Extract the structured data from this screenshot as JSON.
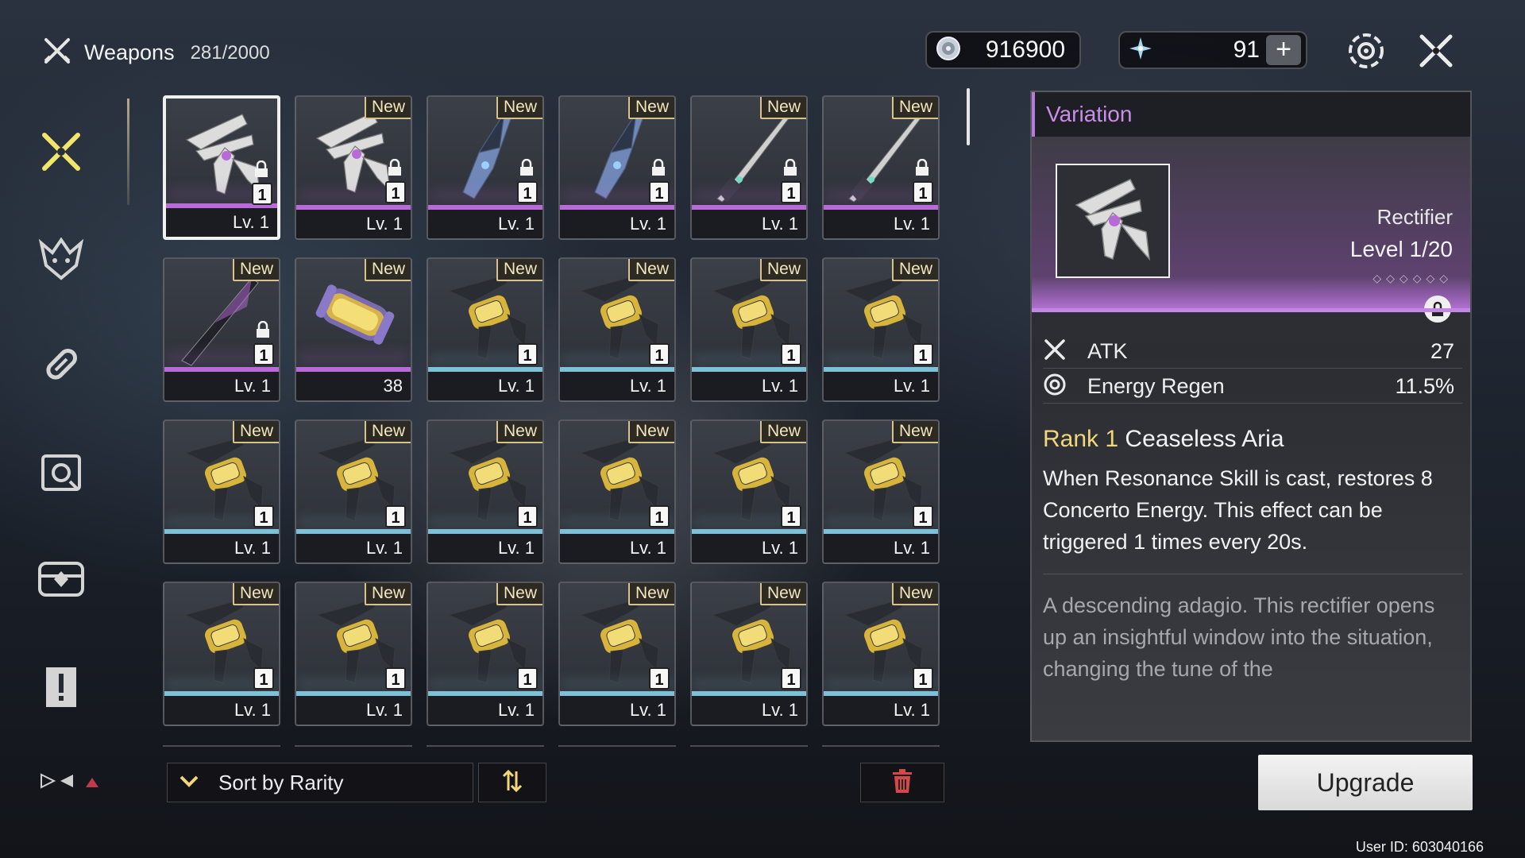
{
  "header": {
    "title": "Weapons",
    "count": "281/2000"
  },
  "currencies": [
    {
      "icon": "shell-credit-icon",
      "value": "916900"
    },
    {
      "icon": "astrite-icon",
      "value": "91",
      "plus": "+"
    }
  ],
  "top_icons": [
    "settings-gear-icon",
    "close-crossed-swords-icon"
  ],
  "nav": [
    "weapons-nav-icon",
    "echo-nav-icon",
    "device-nav-icon",
    "camera-nav-icon",
    "supply-nav-icon",
    "quest-item-nav-icon"
  ],
  "cards": [
    {
      "img": "rectifier-silver",
      "rar": "purple",
      "new": "",
      "lock": true,
      "badge": "1",
      "lv": "Lv. 1",
      "sel": true
    },
    {
      "img": "rectifier-silver",
      "rar": "purple",
      "new": "New",
      "lock": true,
      "badge": "1",
      "lv": "Lv. 1"
    },
    {
      "img": "gauntlet-blue",
      "rar": "purple",
      "new": "New",
      "lock": true,
      "badge": "1",
      "lv": "Lv. 1"
    },
    {
      "img": "gauntlet-blue",
      "rar": "purple",
      "new": "New",
      "lock": true,
      "badge": "1",
      "lv": "Lv. 1"
    },
    {
      "img": "broadblade-dark",
      "rar": "purple",
      "new": "New",
      "lock": true,
      "badge": "1",
      "lv": "Lv. 1"
    },
    {
      "img": "broadblade-dark",
      "rar": "purple",
      "new": "New",
      "lock": true,
      "badge": "1",
      "lv": "Lv. 1"
    },
    {
      "img": "sword-dark",
      "rar": "purple",
      "new": "New",
      "lock": true,
      "badge": "1",
      "lv": "Lv. 1"
    },
    {
      "img": "energy-core",
      "rar": "purple",
      "new": "New",
      "lock": false,
      "badge": "",
      "lv": "38"
    },
    {
      "img": "pistol-gold",
      "rar": "blue",
      "new": "New",
      "lock": false,
      "badge": "1",
      "lv": "Lv. 1"
    },
    {
      "img": "pistol-gold",
      "rar": "blue",
      "new": "New",
      "lock": false,
      "badge": "1",
      "lv": "Lv. 1"
    },
    {
      "img": "pistol-gold",
      "rar": "blue",
      "new": "New",
      "lock": false,
      "badge": "1",
      "lv": "Lv. 1"
    },
    {
      "img": "pistol-gold",
      "rar": "blue",
      "new": "New",
      "lock": false,
      "badge": "1",
      "lv": "Lv. 1"
    },
    {
      "img": "pistol-gold",
      "rar": "blue",
      "new": "New",
      "lock": false,
      "badge": "1",
      "lv": "Lv. 1"
    },
    {
      "img": "pistol-gold",
      "rar": "blue",
      "new": "New",
      "lock": false,
      "badge": "1",
      "lv": "Lv. 1"
    },
    {
      "img": "pistol-gold",
      "rar": "blue",
      "new": "New",
      "lock": false,
      "badge": "1",
      "lv": "Lv. 1"
    },
    {
      "img": "pistol-gold",
      "rar": "blue",
      "new": "New",
      "lock": false,
      "badge": "1",
      "lv": "Lv. 1"
    },
    {
      "img": "pistol-gold",
      "rar": "blue",
      "new": "New",
      "lock": false,
      "badge": "1",
      "lv": "Lv. 1"
    },
    {
      "img": "pistol-gold",
      "rar": "blue",
      "new": "New",
      "lock": false,
      "badge": "1",
      "lv": "Lv. 1"
    },
    {
      "img": "pistol-gold",
      "rar": "blue",
      "new": "New",
      "lock": false,
      "badge": "1",
      "lv": "Lv. 1"
    },
    {
      "img": "pistol-gold",
      "rar": "blue",
      "new": "New",
      "lock": false,
      "badge": "1",
      "lv": "Lv. 1"
    },
    {
      "img": "pistol-gold",
      "rar": "blue",
      "new": "New",
      "lock": false,
      "badge": "1",
      "lv": "Lv. 1"
    },
    {
      "img": "pistol-gold",
      "rar": "blue",
      "new": "New",
      "lock": false,
      "badge": "1",
      "lv": "Lv. 1"
    },
    {
      "img": "pistol-gold",
      "rar": "blue",
      "new": "New",
      "lock": false,
      "badge": "1",
      "lv": "Lv. 1"
    },
    {
      "img": "pistol-gold",
      "rar": "blue",
      "new": "New",
      "lock": false,
      "badge": "1",
      "lv": "Lv. 1"
    }
  ],
  "sort": {
    "label": "Sort by Rarity"
  },
  "detail": {
    "section": "Variation",
    "type": "Rectifier",
    "level": "Level 1/20",
    "stats": [
      {
        "icon": "atk-icon",
        "name": "ATK",
        "value": "27"
      },
      {
        "icon": "energy-regen-icon",
        "name": "Energy Regen",
        "value": "11.5%"
      }
    ],
    "rank_label": "Rank 1",
    "passive_name": "Ceaseless Aria",
    "passive_desc": "When Resonance Skill is cast, restores 8 Concerto Energy. This effect can be triggered 1 times every 20s.",
    "lore": "A descending adagio. This rectifier opens up an insightful window into the situation, changing the tune of the"
  },
  "upgrade_label": "Upgrade",
  "user_id": "User ID: 603040166",
  "colors": {
    "purple_rarity": "#b76ad8",
    "blue_rarity": "#7ec0d8",
    "new_gold": "#d6c28a",
    "rank_yellow": "#f1d77a",
    "accent_violet": "#c88ee8"
  }
}
